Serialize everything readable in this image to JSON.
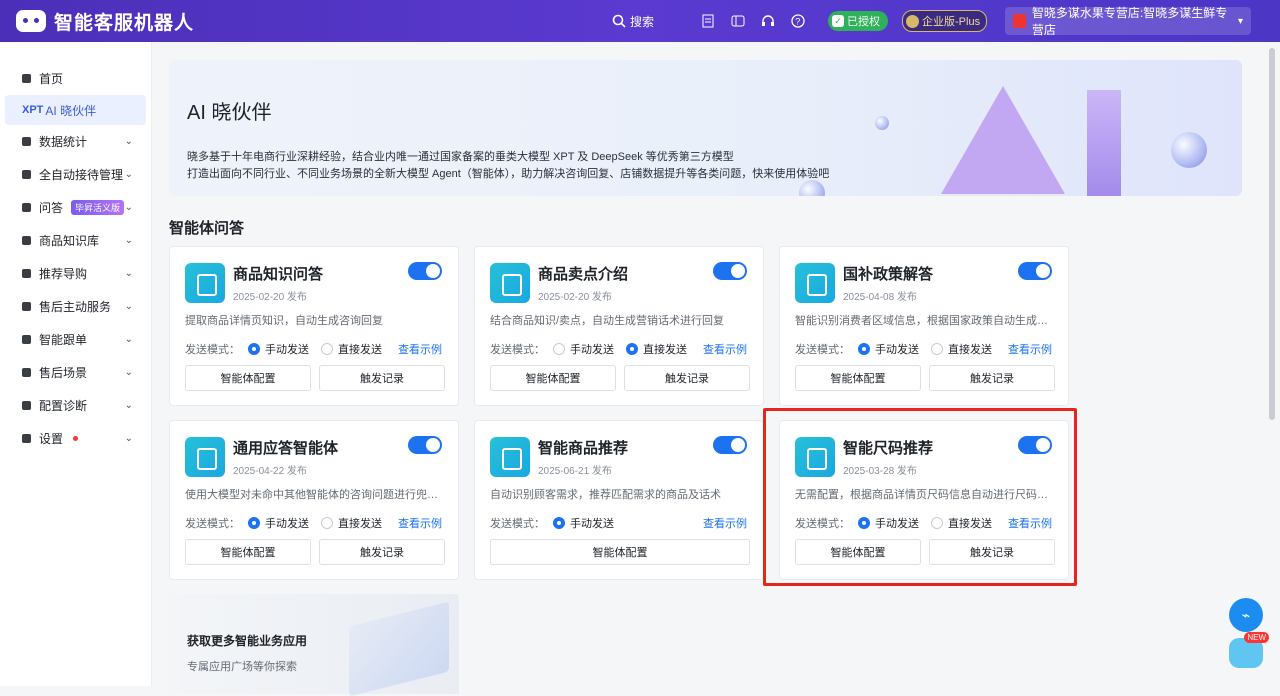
{
  "header": {
    "app_name": "智能客服机器人",
    "search_label": "搜索",
    "auth_badge": "已授权",
    "edition_badge": "企业版-Plus",
    "store_name": "智晓多谋水果专营店:智晓多谋生鲜专营店"
  },
  "sidebar": {
    "items": [
      {
        "label": "首页",
        "icon": "home-icon",
        "has_arrow": false
      },
      {
        "label": "AI 晓伙伴",
        "prefix": "XPT",
        "active": true
      },
      {
        "label": "数据统计",
        "icon": "chart-icon",
        "has_arrow": true
      },
      {
        "label": "全自动接待管理",
        "icon": "reception-icon",
        "has_arrow": true
      },
      {
        "label": "问答",
        "icon": "qa-icon",
        "badge": "毕昇活义版",
        "has_arrow": true
      },
      {
        "label": "商品知识库",
        "icon": "bag-icon",
        "has_arrow": true
      },
      {
        "label": "推荐导购",
        "icon": "recommend-icon",
        "has_arrow": true
      },
      {
        "label": "售后主动服务",
        "icon": "service-icon",
        "has_arrow": true
      },
      {
        "label": "智能跟单",
        "icon": "order-icon",
        "has_arrow": true
      },
      {
        "label": "售后场景",
        "icon": "scene-icon",
        "has_arrow": true
      },
      {
        "label": "配置诊断",
        "icon": "diagnose-icon",
        "has_arrow": true
      },
      {
        "label": "设置",
        "icon": "gear-icon",
        "has_dot": true,
        "has_arrow": true
      }
    ]
  },
  "banner": {
    "title": "AI 晓伙伴",
    "line1": "晓多基于十年电商行业深耕经验，结合业内唯一通过国家备案的垂类大模型 XPT 及 DeepSeek 等优秀第三方模型",
    "line2": "打造出面向不同行业、不同业务场景的全新大模型 Agent（智能体），助力解决咨询回复、店铺数据提升等各类问题，快来使用体验吧"
  },
  "section": {
    "title": "智能体问答"
  },
  "common": {
    "mode_label": "发送模式：",
    "manual": "手动发送",
    "direct": "直接发送",
    "example": "查看示例",
    "config": "智能体配置",
    "record": "触发记录"
  },
  "cards": [
    {
      "title": "商品知识问答",
      "date": "2025-02-20 发布",
      "desc": "提取商品详情页知识，自动生成咨询回复",
      "mode": "manual",
      "enabled": true
    },
    {
      "title": "商品卖点介绍",
      "date": "2025-02-20 发布",
      "desc": "结合商品知识/卖点，自动生成营销话术进行回复",
      "mode": "direct",
      "enabled": true
    },
    {
      "title": "国补政策解答",
      "date": "2025-04-08 发布",
      "desc": "智能识别消费者区域信息，根据国家政策自动生成准确回复",
      "mode": "manual",
      "enabled": true
    },
    {
      "title": "通用应答智能体",
      "date": "2025-04-22 发布",
      "desc": "使用大模型对未命中其他智能体的咨询问题进行兜底回复",
      "mode": "manual",
      "enabled": true
    },
    {
      "title": "智能商品推荐",
      "date": "2025-06-21 发布",
      "desc": "自动识别顾客需求，推荐匹配需求的商品及话术",
      "mode": "manual",
      "enabled": true
    },
    {
      "title": "智能尺码推荐",
      "date": "2025-03-28 发布",
      "desc": "无需配置，根据商品详情页尺码信息自动进行尺码推荐",
      "mode": "manual",
      "enabled": true
    }
  ],
  "promo": {
    "title": "获取更多智能业务应用",
    "subtitle": "专属应用广场等你探索"
  },
  "float": {
    "new_badge": "NEW"
  },
  "colors": {
    "primary": "#1d72f0",
    "topbar": "#4b2fb8",
    "highlight": "#e5261f"
  }
}
